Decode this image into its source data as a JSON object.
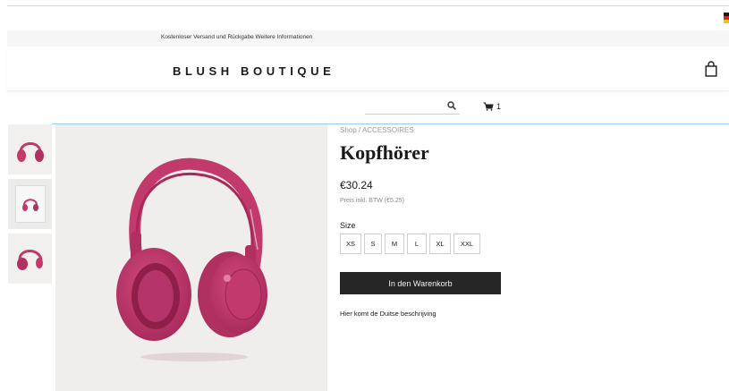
{
  "announcement": {
    "text": "Kostenloser Versand und Rückgabe Weitere Informationen"
  },
  "header": {
    "brand": "BLUSH BOUTIQUE",
    "bag_icon": "shopping-bag-icon",
    "flag_icon": "german-flag-icon"
  },
  "toolbar": {
    "search_placeholder": "",
    "search_icon": "search-icon",
    "cart_icon": "cart-icon",
    "cart_count": "1"
  },
  "breadcrumb": {
    "shop": "Shop",
    "separator": "/",
    "category": "ACCESSOIRES"
  },
  "product": {
    "title": "Kopfhörer",
    "price": "€30.24",
    "tax_info": "Preis inkl. BTW (€5.25)",
    "size_label": "Size",
    "sizes": [
      "XS",
      "S",
      "M",
      "L",
      "XL",
      "XXL"
    ],
    "add_to_cart": "In den Warenkorb",
    "description": "Hier komt de Duitse beschrijving"
  },
  "colors": {
    "accent_dark": "#262626",
    "product_pink": "#c23a6b",
    "gallery_bg": "#efeeec",
    "focus_line": "#9ec9ef"
  }
}
